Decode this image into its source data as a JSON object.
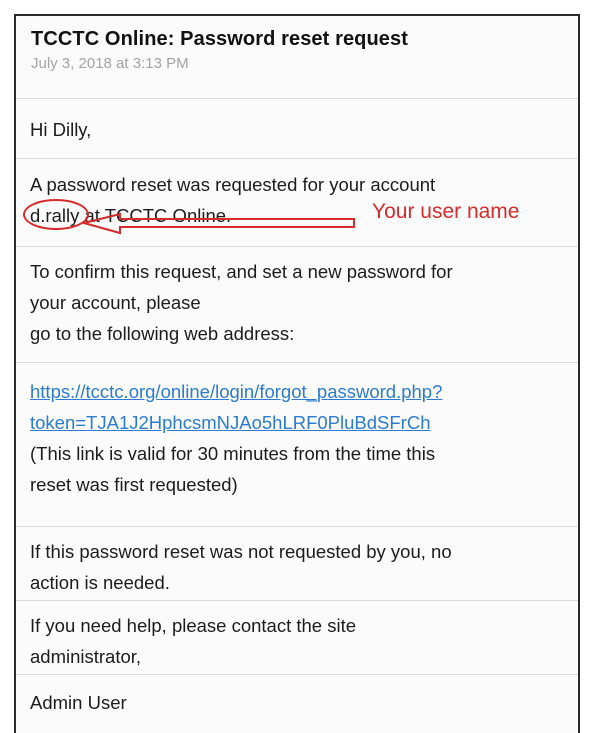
{
  "email": {
    "subject": "TCCTC Online: Password reset request",
    "date": "July 3, 2018 at 3:13 PM",
    "greeting": "Hi Dilly,",
    "reset_line1": "A password reset was requested for your account",
    "username": "d.rally",
    "reset_line2_rest": " at TCCTC Online.",
    "confirm_line1": "To confirm this request, and set a new password for",
    "confirm_line2": "your account, please",
    "confirm_line3": "go to the following web address:",
    "link_line1": "https://tcctc.org/online/login/forgot_password.php?",
    "link_line2": "token=TJA1J2HphcsmNJAo5hLRF0PluBdSFrCh",
    "valid_line1": "(This link is valid for 30 minutes from the time this",
    "valid_line2": "reset was first  requested)",
    "notreq_line1": "If this password reset was not requested by you, no",
    "notreq_line2": "action is needed.",
    "help_line1": "If you need help, please contact the site",
    "help_line2": "administrator,",
    "signature": "Admin User"
  },
  "annotation": {
    "label": "Your user name",
    "color": "#d62b2b"
  },
  "colors": {
    "link": "#2b7bd1",
    "date": "#a3a3a3",
    "border": "#2b2b2b"
  }
}
